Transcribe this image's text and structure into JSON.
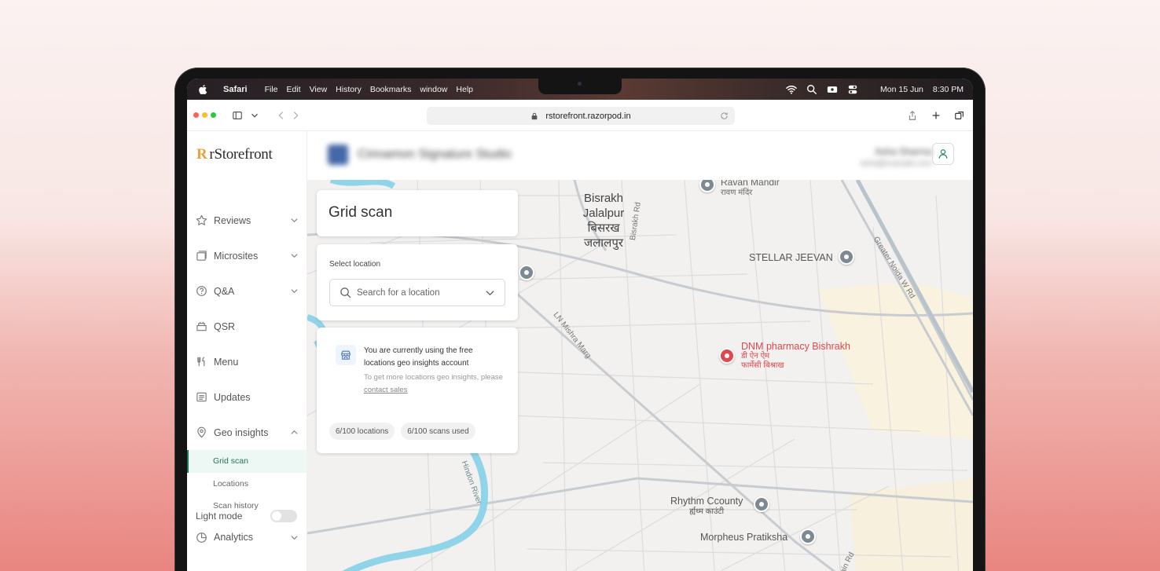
{
  "menubar": {
    "app": "Safari",
    "items": [
      "File",
      "Edit",
      "View",
      "History",
      "Bookmarks",
      "window",
      "Help"
    ],
    "date": "Mon 15 Jun",
    "time": "8:30 PM",
    "icons": [
      "apple-logo-icon",
      "wifi-icon",
      "search-icon",
      "screen-record-icon",
      "control-center-icon"
    ]
  },
  "browser": {
    "url": "rstorefront.razorpod.in",
    "traffic_colors": [
      "#ff5f57",
      "#febc2e",
      "#28c840"
    ]
  },
  "sidebar": {
    "brand_mark": "R",
    "brand_name": "rStorefront",
    "items": [
      {
        "label": "Reviews",
        "icon": "star-icon"
      },
      {
        "label": "Microsites",
        "icon": "microsites-icon"
      },
      {
        "label": "Q&A",
        "icon": "question-icon"
      },
      {
        "label": "QSR",
        "icon": "qsr-icon"
      },
      {
        "label": "Menu",
        "icon": "fork-knife-icon"
      },
      {
        "label": "Updates",
        "icon": "updates-icon"
      },
      {
        "label": "Geo insights",
        "icon": "location-pin-icon"
      }
    ],
    "geo_sub": [
      "Grid scan",
      "Locations",
      "Scan history"
    ],
    "analytics": "Analytics",
    "light_mode": "Light mode"
  },
  "header": {
    "business_name": "Cinnamon Signature Studio",
    "user_name": "Asha Sharma",
    "user_email": "asha@example.com"
  },
  "grid": {
    "title": "Grid scan",
    "select_label": "Select location",
    "search_placeholder": "Search for a location",
    "info_line1": "You are currently using the free locations geo insights account",
    "info_line2_prefix": "To get more locations geo insights, please",
    "info_link": "contact sales",
    "chip_locations": "6/100  locations",
    "chip_scans": "6/100  scans used"
  },
  "map": {
    "labels": {
      "bisrakh_en": "Bisrakh Jalalpur",
      "bisrakh_hi": "बिसरख जलालपुर",
      "ravan_en": "Ravan Mandir",
      "ravan_hi": "रावण मंदिर",
      "stellar": "STELLAR JEEVAN",
      "dnm_en": "DNM pharmacy Bishrakh",
      "dnm_hi": "डी ऐन ऐम फार्मेसी बिश्राख",
      "rhythm_en": "Rhythm Ccounty",
      "rhythm_hi": "र्ह्यथ्म काउंटी",
      "morpheus": "Morpheus Pratiksha",
      "bisrakh_rd": "Bisrakh Rd",
      "greater_noida": "Greater Noida W Rd",
      "ln_mishra": "LN Mishra Marg",
      "hindon": "Hindon River",
      "ain_rd": "ain Rd"
    },
    "river_color": "#8fd4e8",
    "pharmacy_color": "#e0474c"
  }
}
